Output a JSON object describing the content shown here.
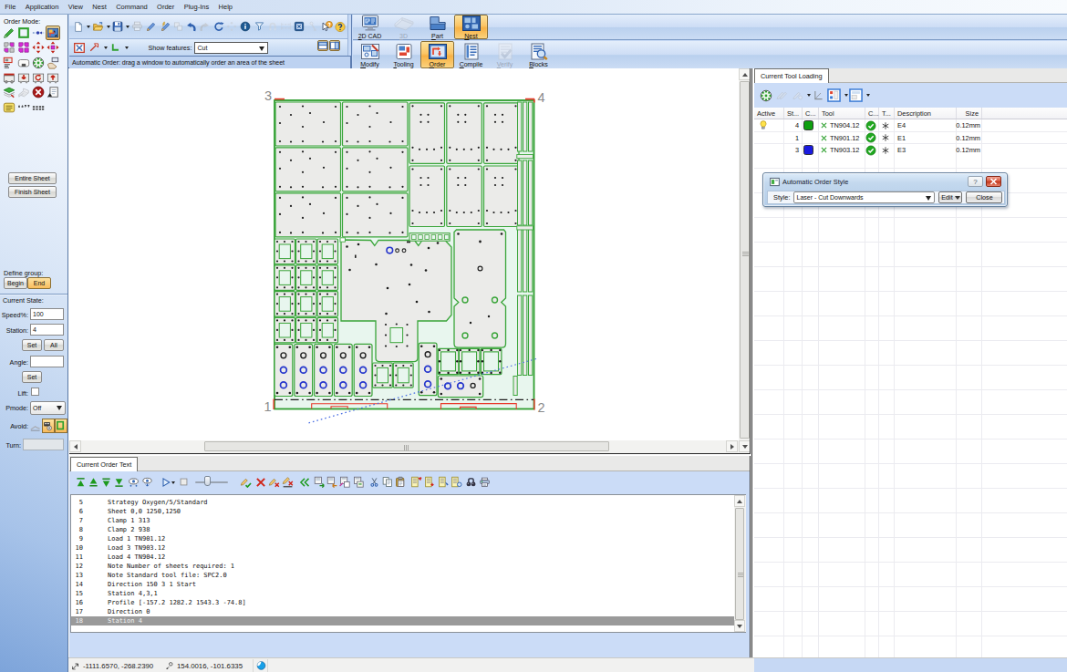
{
  "menu": {
    "items": [
      "File",
      "Application",
      "View",
      "Nest",
      "Command",
      "Order",
      "Plug-Ins",
      "Help"
    ]
  },
  "left_panel": {
    "title": "Order Mode:",
    "entire_sheet": "Entire Sheet",
    "finish_sheet": "Finish Sheet",
    "define_group_label": "Define group:",
    "begin": "Begin",
    "end": "End",
    "current_state_label": "Current State:",
    "speed_label": "Speed%:",
    "speed_value": "100",
    "station_label": "Station:",
    "station_value": "4",
    "set_label": "Set",
    "all_label": "All",
    "angle_label": "Angle:",
    "angle_value": "",
    "set2_label": "Set",
    "lift_label": "Lift:",
    "pmode_label": "Pmode:",
    "pmode_value": "Off",
    "avoid_label": "Avoid:",
    "turn_label": "Turn:",
    "turn_value": ""
  },
  "toolbar2": {
    "show_features_label": "Show features:",
    "show_features_value": "Cut"
  },
  "hint_bar": "Automatic Order: drag a window to automatically order an area of the sheet",
  "big_buttons": {
    "row1": [
      {
        "label": "2D CAD",
        "icon": "bb-cad",
        "state": "normal"
      },
      {
        "label": "3D",
        "icon": "bb-3d",
        "state": "disabled"
      },
      {
        "label": "Part",
        "icon": "bb-part",
        "state": "normal"
      },
      {
        "label": "Nest",
        "icon": "bb-nest",
        "state": "active"
      }
    ],
    "row2": [
      {
        "label": "Modify",
        "icon": "bb-modify",
        "state": "normal"
      },
      {
        "label": "Tooling",
        "icon": "bb-tooling",
        "state": "normal"
      },
      {
        "label": "Order",
        "icon": "bb-order",
        "state": "active"
      },
      {
        "label": "Compile",
        "icon": "bb-compile",
        "state": "normal"
      },
      {
        "label": "Verify",
        "icon": "bb-verify",
        "state": "disabled"
      },
      {
        "label": "Blocks",
        "icon": "bb-blocks",
        "state": "normal"
      }
    ]
  },
  "right_panel": {
    "tab": "Current Tool Loading",
    "table": {
      "columns": [
        "Active",
        "St...",
        "C...",
        "Tool",
        "C...",
        "T...",
        "Description",
        "Size"
      ],
      "rows": [
        {
          "active": true,
          "station": "4",
          "color": "#0fa00f",
          "tool": "TN904.12",
          "ok": true,
          "t": true,
          "description": "E4",
          "size": "0.12mm"
        },
        {
          "active": false,
          "station": "1",
          "color": "",
          "tool": "TN901.12",
          "ok": true,
          "t": true,
          "description": "E1",
          "size": "0.12mm"
        },
        {
          "active": false,
          "station": "3",
          "color": "#1a1ae0",
          "tool": "TN903.12",
          "ok": true,
          "t": true,
          "description": "E3",
          "size": "0.12mm"
        }
      ]
    }
  },
  "dialog": {
    "title": "Automatic Order Style",
    "style_label": "Style:",
    "style_value": "Laser - Cut Downwards",
    "edit_label": "Edit",
    "close_label": "Close"
  },
  "bottom_panel": {
    "tab": "Current Order Text",
    "lines": [
      {
        "num": "5",
        "text": "Strategy Oxygen/5/Standard",
        "selected": false
      },
      {
        "num": "6",
        "text": "Sheet 0,0 1250,1250",
        "selected": false
      },
      {
        "num": "7",
        "text": "Clamp 1 313",
        "selected": false
      },
      {
        "num": "8",
        "text": "Clamp 2 938",
        "selected": false
      },
      {
        "num": "9",
        "text": "Load 1 TN901.12",
        "selected": false
      },
      {
        "num": "10",
        "text": "Load 3 TN903.12",
        "selected": false
      },
      {
        "num": "11",
        "text": "Load 4 TN904.12",
        "selected": false
      },
      {
        "num": "12",
        "text": "Note Number of sheets required: 1",
        "selected": false
      },
      {
        "num": "13",
        "text": "Note Standard tool file: SPC2.0",
        "selected": false
      },
      {
        "num": "14",
        "text": "Direction 150 3 1 Start",
        "selected": false
      },
      {
        "num": "15",
        "text": "Station 4,3,1",
        "selected": false
      },
      {
        "num": "16",
        "text": "Profile [-157.2 1282.2 1543.3 -74.8]",
        "selected": false
      },
      {
        "num": "17",
        "text": "Direction 0",
        "selected": false
      },
      {
        "num": "18",
        "text": "Station 4",
        "selected": true
      }
    ]
  },
  "status_bar": {
    "coords1": "-1111.6570, -268.2390",
    "coords2": "154.0016, -101.6335"
  },
  "sheet": {
    "corner_labels": {
      "bl": "1",
      "br": "2",
      "tl": "3",
      "tr": "4"
    }
  },
  "colors": {
    "accent_orange": "#f9bd5e",
    "part_green": "#3aa53a",
    "sheet_mint": "#e3f4ea",
    "hole_blue": "#2636cc",
    "clamp_red": "#e8392b"
  }
}
